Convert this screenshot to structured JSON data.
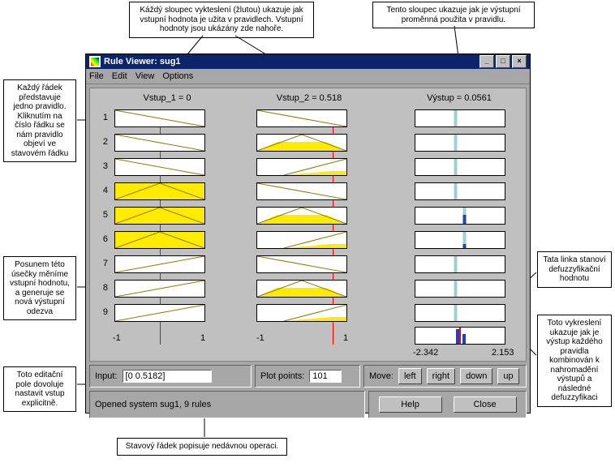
{
  "callouts": {
    "top_left": "Káždý sloupec vykteslení (žlutou) ukazuje jak vstupní hodnota je užita v pravidlech. Vstupní hodnoty jsou ukázány zde nahoře.",
    "top_right": "Tento sloupec ukazuje jak je výstupní proměnná použita v pravidlu.",
    "left_rows": "Každý řádek představuje jedno pravidlo. Kliknutím na číslo řádku se nám pravidlo objeví ve stavovém řádku",
    "left_slider": "Posunem této úsečky měníme vstupní hodnotu, a generuje se nová výstupní odezva",
    "left_input": "Toto editační pole dovoluje nastavit vstup explicitně.",
    "right_defuzz": "Tata linka stanoví defuzzyfikační hodnotu",
    "right_agg": "Toto vykreslení ukazuje jak je výstup každého pravidla kombinován k nahromadění výstupů a následné defuzzyfikaci",
    "bottom_status": "Stavový řádek popisuje nedávnou operaci."
  },
  "window": {
    "title": "Rule Viewer: sug1",
    "menu": {
      "file": "File",
      "edit": "Edit",
      "view": "View",
      "options": "Options"
    },
    "columns": {
      "in1": "Vstup_1 = 0",
      "in2": "Vstup_2 = 0.518",
      "out": "Výstup = 0.0561"
    },
    "row_numbers": [
      "1",
      "2",
      "3",
      "4",
      "5",
      "6",
      "7",
      "8",
      "9"
    ],
    "axis": {
      "in_min": "-1",
      "in_max": "1",
      "out_min": "-2.342",
      "out_max": "2.153"
    },
    "input_panel": {
      "input_label": "Input:",
      "input_value": "[0 0.5182]",
      "plot_label": "Plot points:",
      "plot_value": "101",
      "move_label": "Move:",
      "left": "left",
      "right": "right",
      "down": "down",
      "up": "up"
    },
    "status": "Opened system sug1, 9 rules",
    "help": "Help",
    "close": "Close"
  },
  "chart_data": {
    "type": "table",
    "inputs": {
      "Vstup_1": 0,
      "Vstup_2": 0.518
    },
    "output": {
      "name": "Výstup",
      "value": 0.0561,
      "range": [
        -2.342,
        2.153
      ]
    },
    "input_range": [
      -1,
      1
    ],
    "rules_count": 9,
    "rules": [
      {
        "n": 1,
        "mf1": "desc",
        "fire1": 0.0,
        "mf2": "desc",
        "fire2": 0.0,
        "out_pos": 0.45
      },
      {
        "n": 2,
        "mf1": "desc",
        "fire1": 0.0,
        "mf2": "tri-cl",
        "fire2": 0.55,
        "out_pos": 0.45
      },
      {
        "n": 3,
        "mf1": "desc",
        "fire1": 0.0,
        "mf2": "tri-r",
        "fire2": 0.25,
        "out_pos": 0.45
      },
      {
        "n": 4,
        "mf1": "tri-cl",
        "fire1": 1.0,
        "mf2": "desc",
        "fire2": 0.0,
        "out_pos": 0.45
      },
      {
        "n": 5,
        "mf1": "tri-cl",
        "fire1": 1.0,
        "mf2": "tri-cl",
        "fire2": 0.55,
        "out_pos": 0.55
      },
      {
        "n": 6,
        "mf1": "tri-cl",
        "fire1": 1.0,
        "mf2": "tri-r",
        "fire2": 0.25,
        "out_pos": 0.55
      },
      {
        "n": 7,
        "mf1": "asc",
        "fire1": 0.0,
        "mf2": "desc",
        "fire2": 0.0,
        "out_pos": 0.45
      },
      {
        "n": 8,
        "mf1": "asc",
        "fire1": 0.0,
        "mf2": "tri-cl",
        "fire2": 0.55,
        "out_pos": 0.45
      },
      {
        "n": 9,
        "mf1": "asc",
        "fire1": 0.0,
        "mf2": "tri-r",
        "fire2": 0.25,
        "out_pos": 0.45
      }
    ]
  }
}
